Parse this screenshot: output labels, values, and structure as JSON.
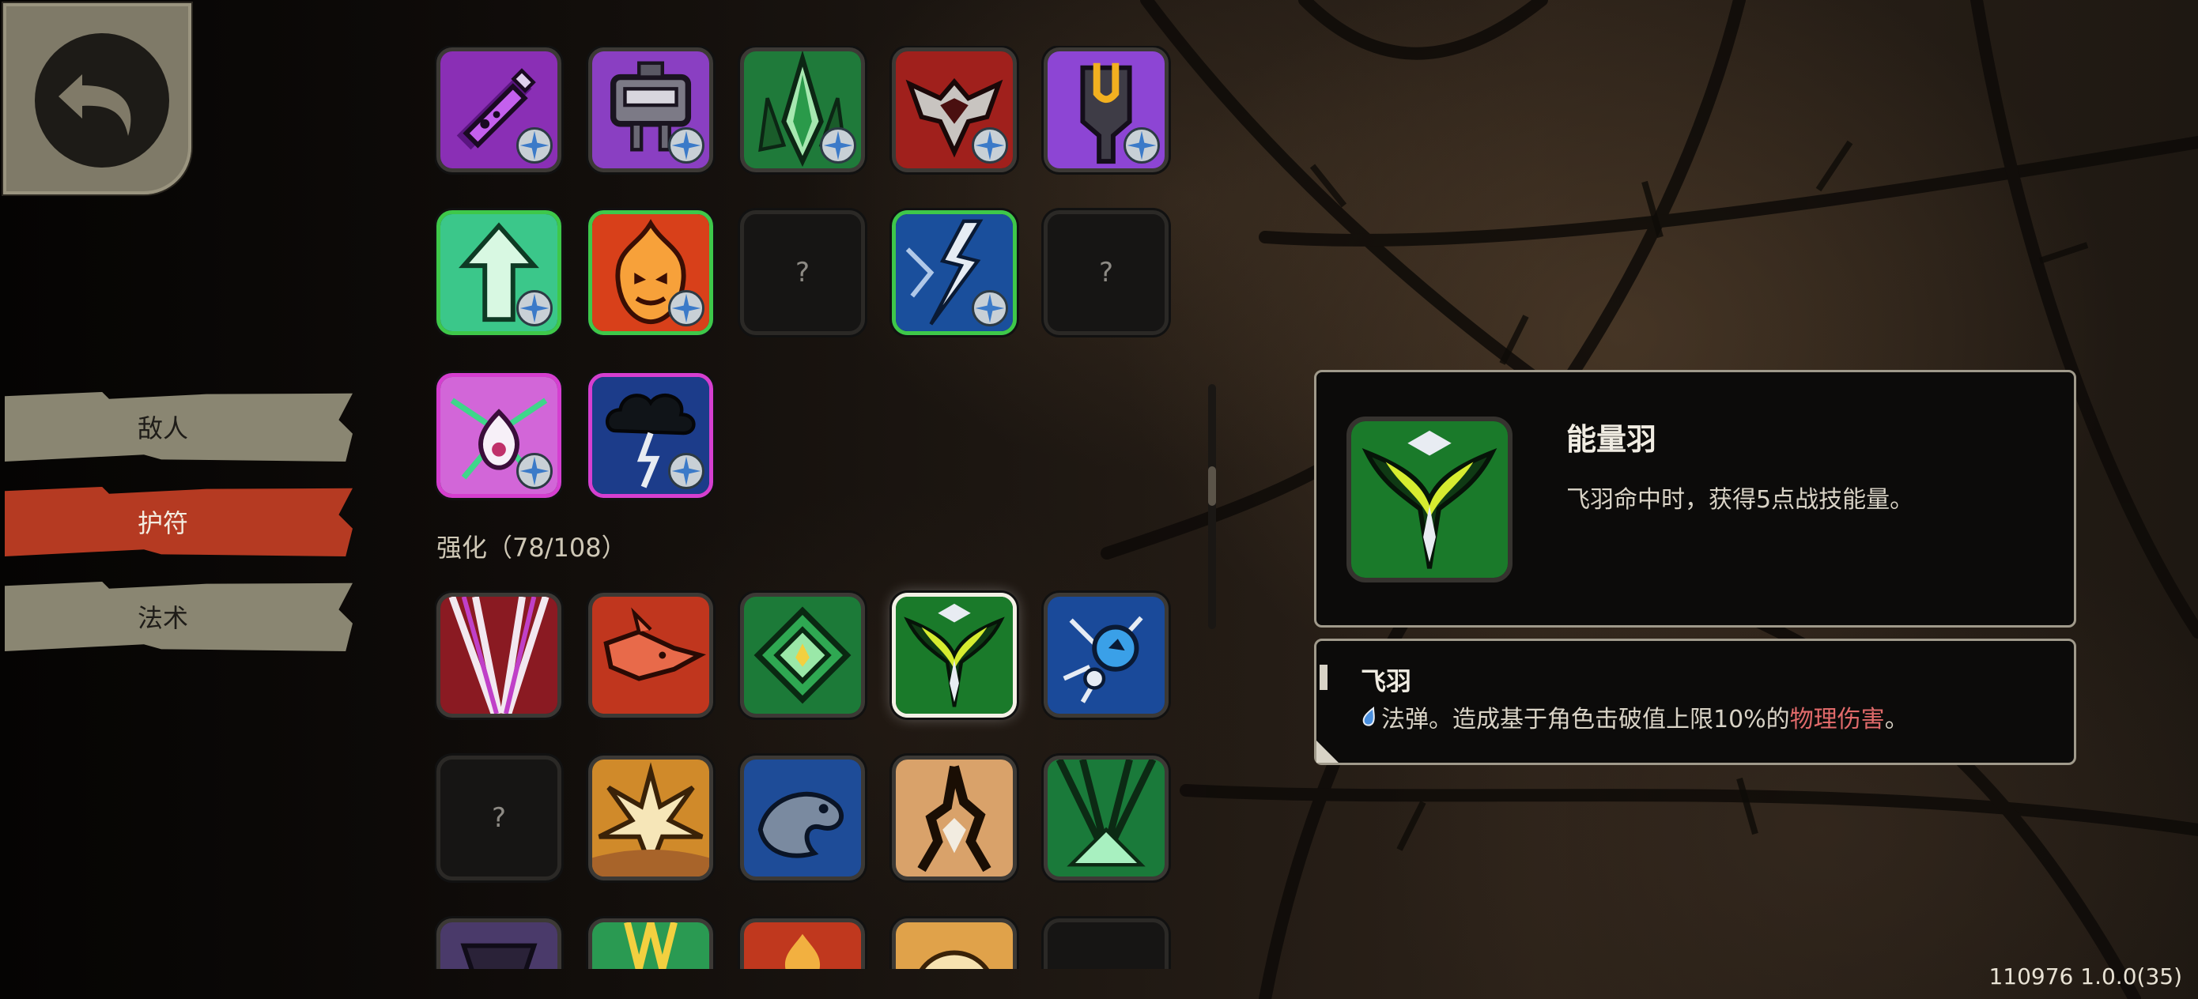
{
  "tabs": {
    "enemy": "敌人",
    "charm": "护符",
    "spell": "法术",
    "active": "charm"
  },
  "enhance_section": {
    "title": "强化（78/108）"
  },
  "unknown_mark": "?",
  "detail": {
    "title": "能量羽",
    "description": "飞羽命中时，获得5点战技能量。"
  },
  "sub_detail": {
    "title": "飞羽",
    "prefix": "法弹。造成基于角色击破值上限10%的",
    "highlight": "物理伤害",
    "suffix": "。"
  },
  "version": "110976 1.0.0(35)",
  "colors": {
    "active_tab": "#b53a22",
    "highlight_text": "#e06a6a",
    "rare_border": "#3ec84a",
    "epic_border": "#d53fd0"
  }
}
